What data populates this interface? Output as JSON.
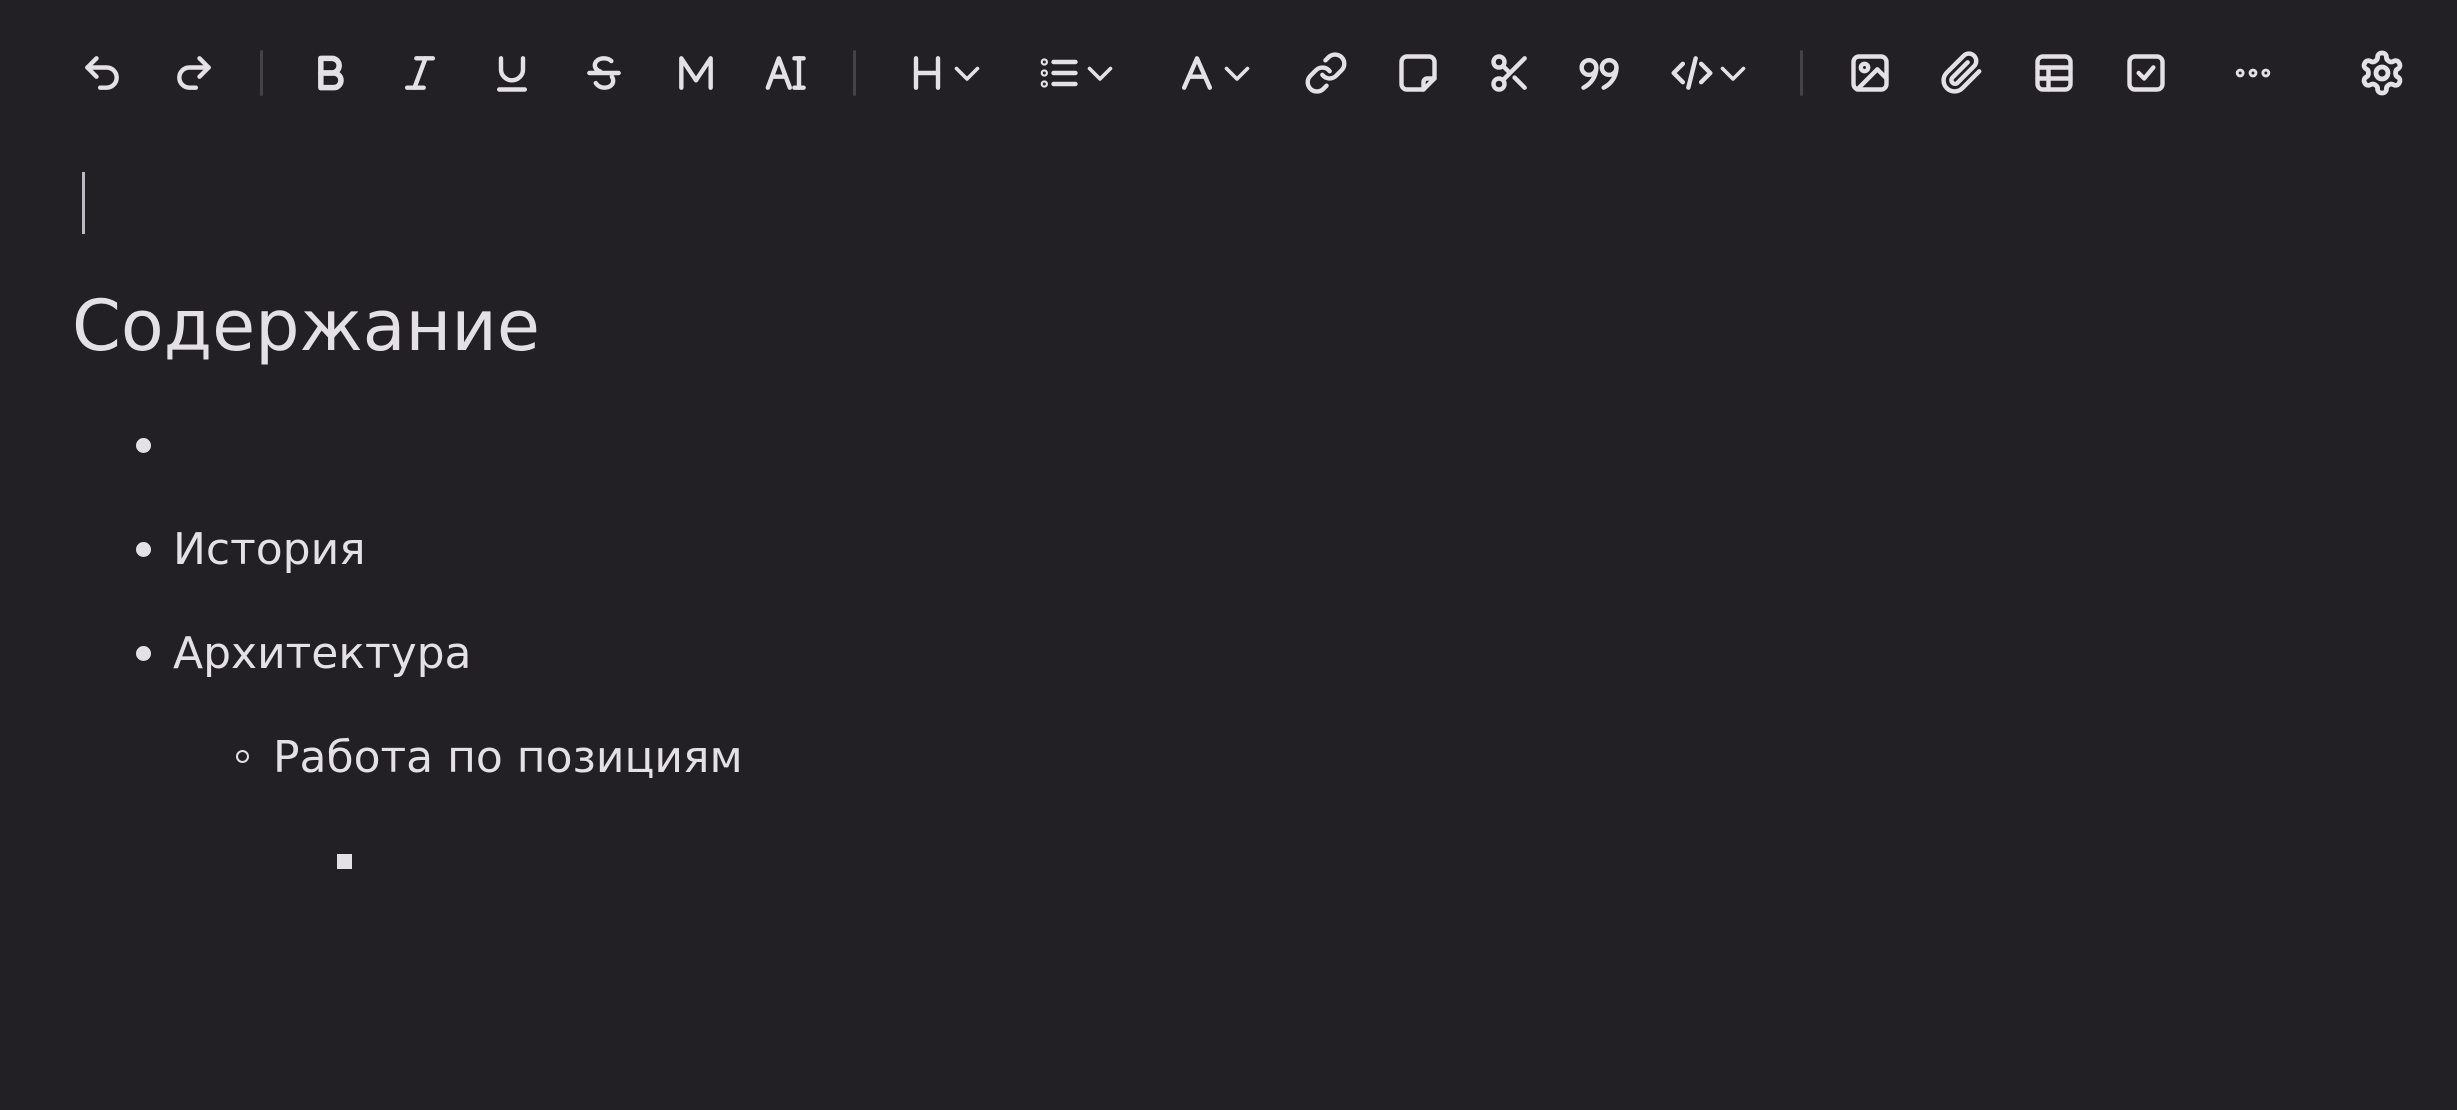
{
  "toolbar": {
    "buttons": [
      {
        "name": "undo-icon"
      },
      {
        "name": "redo-icon"
      },
      {
        "name": "bold-icon"
      },
      {
        "name": "italic-icon"
      },
      {
        "name": "underline-icon"
      },
      {
        "name": "strikethrough-icon"
      },
      {
        "name": "math-icon"
      },
      {
        "name": "text-size-icon"
      },
      {
        "name": "heading-dropdown-icon",
        "label": "H"
      },
      {
        "name": "list-dropdown-icon"
      },
      {
        "name": "text-color-dropdown-icon",
        "label": "A"
      },
      {
        "name": "link-icon"
      },
      {
        "name": "sticky-note-icon"
      },
      {
        "name": "cut-icon"
      },
      {
        "name": "quote-icon"
      },
      {
        "name": "code-dropdown-icon"
      },
      {
        "name": "image-icon"
      },
      {
        "name": "attachment-icon"
      },
      {
        "name": "table-icon"
      },
      {
        "name": "checkbox-icon"
      },
      {
        "name": "more-icon"
      },
      {
        "name": "settings-icon"
      }
    ]
  },
  "document": {
    "heading": "Содержание",
    "list": [
      {
        "level": 1,
        "marker": "disc",
        "text": ""
      },
      {
        "level": 1,
        "marker": "disc",
        "text": "История"
      },
      {
        "level": 1,
        "marker": "disc",
        "text": "Архитектура"
      },
      {
        "level": 2,
        "marker": "circle",
        "text": "Работа по позициям"
      },
      {
        "level": 3,
        "marker": "square",
        "text": ""
      }
    ]
  },
  "colors": {
    "background": "#221f25",
    "text": "#e4e1e6",
    "separator": "#45414a"
  }
}
